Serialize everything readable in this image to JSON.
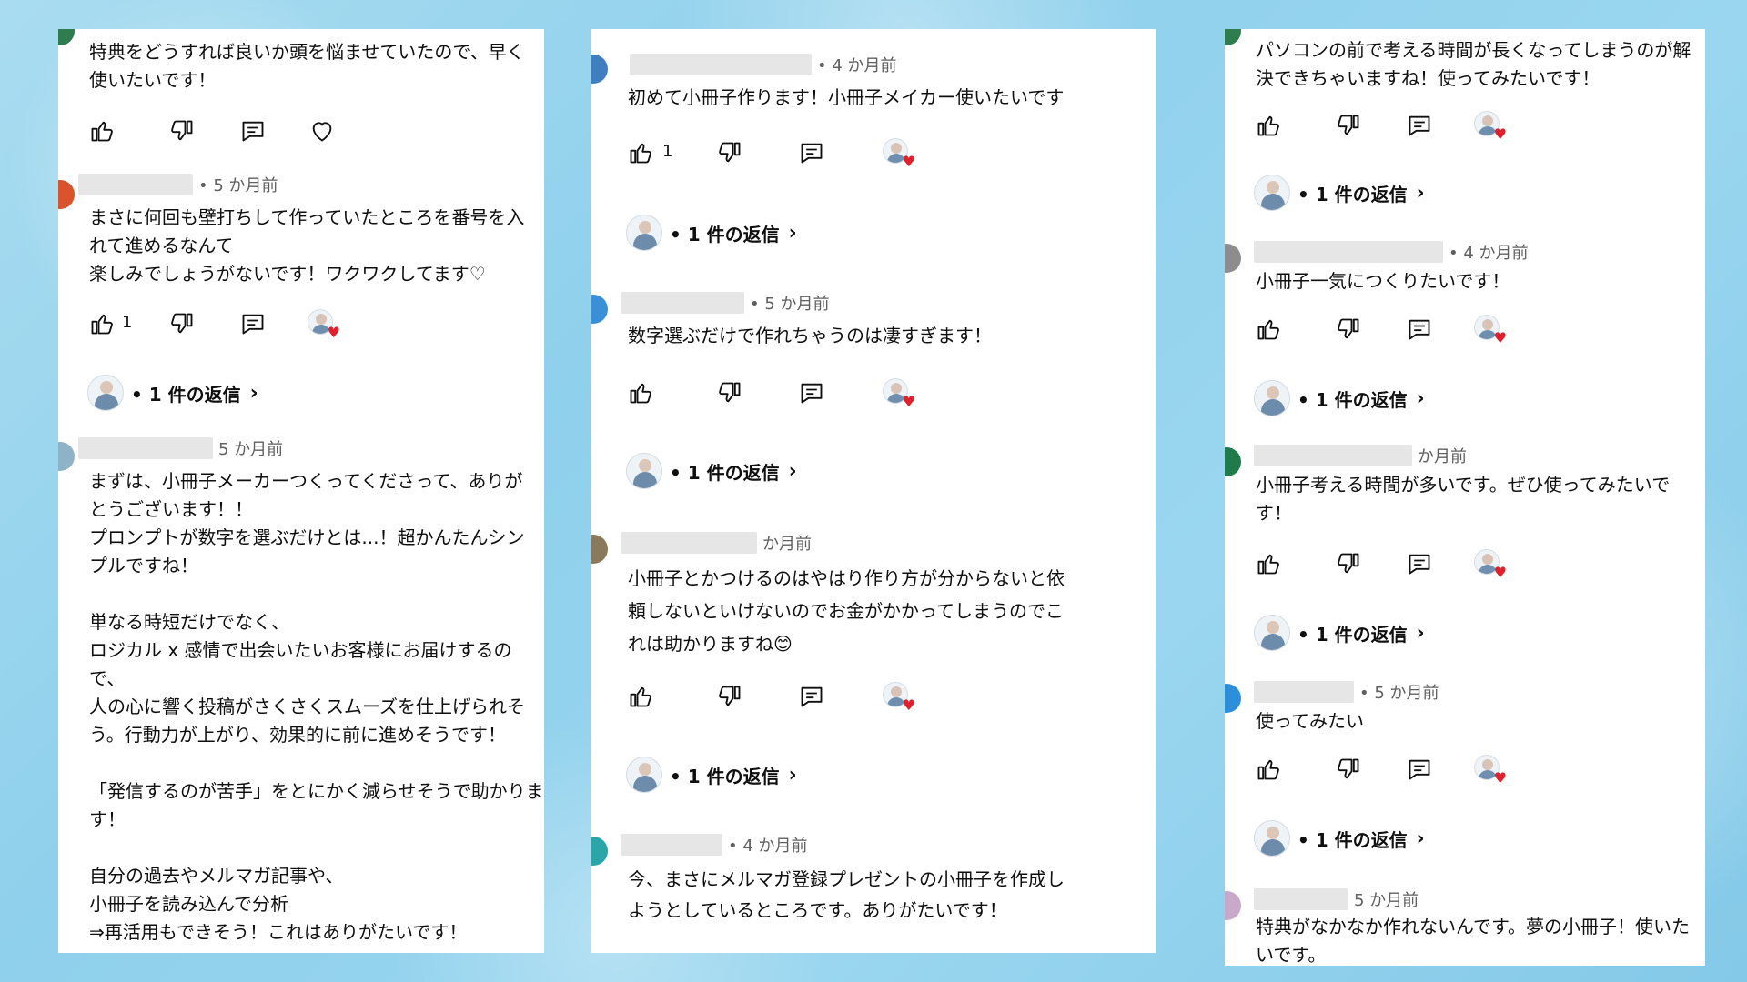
{
  "colors": {
    "accent_heart": "#e0202b",
    "text": "#0f0f0f",
    "meta": "#606060"
  },
  "icons": [
    "thumbs-up-icon",
    "thumbs-down-icon",
    "reply-icon",
    "heart-icon",
    "creator-heart-icon",
    "chevron-right-icon"
  ],
  "panel1": {
    "c0": {
      "body": "特典をどうすれば良いか頭を悩ませていたので、早く\n使いたいです！"
    },
    "c1": {
      "time": "• 5 か月前",
      "body": "まさに何回も壁打ちして作っていたところを番号を入\nれて進めるなんて\n楽しみでしょうがないです！ワクワクしてます♡",
      "likes": "1",
      "replies": "• 1 件の返信"
    },
    "c2": {
      "time": "5 か月前",
      "body": "まずは、小冊子メーカーつくってくださって、ありが\nとうございます！！\nプロンプトが数字を選ぶだけとは...！超かんたんシン\nプルですね！\n\n単なる時短だけでなく、\nロジカル x 感情で出会いたいお客様にお届けするの\nで、\n人の心に響く投稿がさくさくスムーズを仕上げられそ\nう。行動力が上がり、効果的に前に進めそうです！\n\n「発信するのが苦手」をとにかく減らせそうで助かりま\nす！\n\n自分の過去やメルマガ記事や、\n小冊子を読み込んで分析\n⇒再活用もできそう！これはありがたいです！"
    }
  },
  "panel2": {
    "c0": {
      "time": "• 4 か月前",
      "body": "初めて小冊子作ります！小冊子メイカー使いたいです",
      "likes": "1",
      "replies": "• 1 件の返信"
    },
    "c1": {
      "time": "• 5 か月前",
      "body": "数字選ぶだけで作れちゃうのは凄すぎます！",
      "replies": "• 1 件の返信"
    },
    "c2": {
      "time": "か月前",
      "body": "小冊子とかつけるのはやはり作り方が分からないと依\n頼しないといけないのでお金がかかってしまうのでこ\nれは助かりますね😊",
      "replies": "• 1 件の返信"
    },
    "c3": {
      "time": "• 4 か月前",
      "body": "今、まさにメルマガ登録プレゼントの小冊子を作成し\nようとしているところです。ありがたいです！"
    }
  },
  "panel3": {
    "c0": {
      "body": "パソコンの前で考える時間が長くなってしまうのが解\n決できちゃいますね！使ってみたいです！",
      "replies": "• 1 件の返信"
    },
    "c1": {
      "time": "• 4 か月前",
      "body": "小冊子一気につくりたいです！",
      "replies": "• 1 件の返信"
    },
    "c2": {
      "time": "か月前",
      "body": "小冊子考える時間が多いです。ぜひ使ってみたいで\nす！",
      "replies": "• 1 件の返信"
    },
    "c3": {
      "time": "• 5 か月前",
      "body": "使ってみたい",
      "replies": "• 1 件の返信"
    },
    "c4": {
      "time": "5 か月前",
      "body": "特典がなかなか作れないんです。夢の小冊子！使いた\nいです。"
    }
  }
}
